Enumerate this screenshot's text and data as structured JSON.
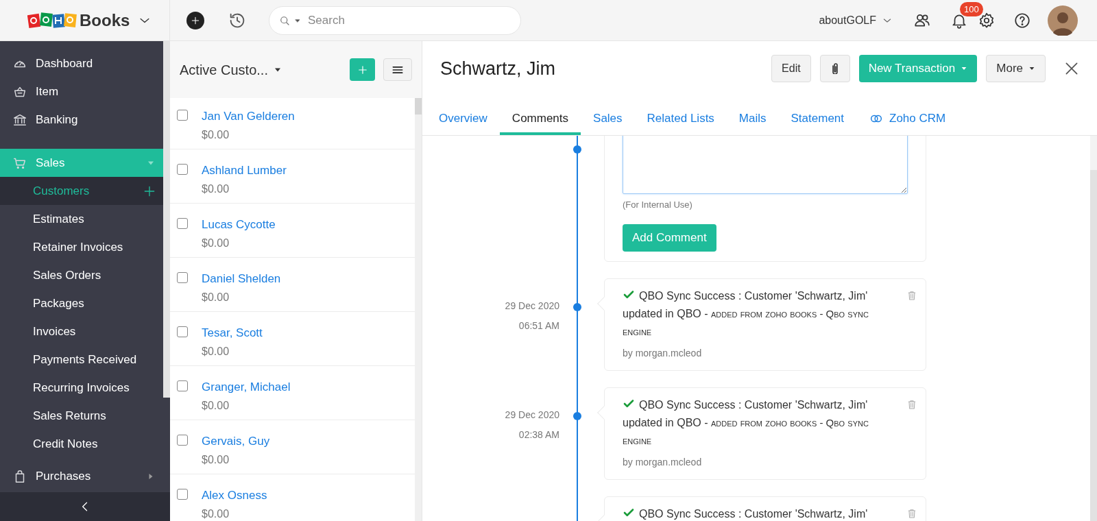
{
  "topbar": {
    "product": "Books",
    "search_placeholder": "Search",
    "organization": "aboutGOLF",
    "notification_count": "100"
  },
  "sidebar": {
    "items": [
      {
        "label": "Dashboard",
        "selected": false
      },
      {
        "label": "Item",
        "selected": false
      },
      {
        "label": "Banking",
        "selected": false
      },
      {
        "label": "Sales",
        "selected": true,
        "expanded": true,
        "children": [
          {
            "label": "Customers",
            "selected": true
          },
          {
            "label": "Estimates",
            "selected": false
          },
          {
            "label": "Retainer Invoices",
            "selected": false
          },
          {
            "label": "Sales Orders",
            "selected": false
          },
          {
            "label": "Packages",
            "selected": false
          },
          {
            "label": "Invoices",
            "selected": false
          },
          {
            "label": "Payments Received",
            "selected": false
          },
          {
            "label": "Recurring Invoices",
            "selected": false
          },
          {
            "label": "Sales Returns",
            "selected": false
          },
          {
            "label": "Credit Notes",
            "selected": false
          }
        ]
      },
      {
        "label": "Purchases",
        "selected": false,
        "expanded": false
      }
    ]
  },
  "customer_list": {
    "view": "Active Custo...",
    "rows": [
      {
        "name": "Jan Van Gelderen",
        "amount": "$0.00",
        "checked": false
      },
      {
        "name": "Ashland Lumber",
        "amount": "$0.00",
        "checked": false
      },
      {
        "name": "Lucas Cycotte",
        "amount": "$0.00",
        "checked": false
      },
      {
        "name": "Daniel Shelden",
        "amount": "$0.00",
        "checked": false
      },
      {
        "name": "Tesar, Scott",
        "amount": "$0.00",
        "checked": false
      },
      {
        "name": "Granger, Michael",
        "amount": "$0.00",
        "checked": false
      },
      {
        "name": "Gervais, Guy",
        "amount": "$0.00",
        "checked": false
      },
      {
        "name": "Alex Osness",
        "amount": "$0.00",
        "checked": false
      }
    ]
  },
  "detail": {
    "title": "Schwartz, Jim",
    "buttons": {
      "edit": "Edit",
      "new_transaction": "New Transaction",
      "more": "More"
    },
    "tabs": [
      {
        "label": "Overview",
        "selected": false
      },
      {
        "label": "Comments",
        "selected": true
      },
      {
        "label": "Sales",
        "selected": false
      },
      {
        "label": "Related Lists",
        "selected": false
      },
      {
        "label": "Mails",
        "selected": false
      },
      {
        "label": "Statement",
        "selected": false
      },
      {
        "label": "Zoho CRM",
        "selected": false
      }
    ],
    "comment_form": {
      "note": "(For Internal Use)",
      "button": "Add Comment"
    },
    "comments": [
      {
        "date": "29 Dec 2020",
        "time": "06:51 AM",
        "message": "QBO Sync Success : Customer 'Schwartz, Jim' updated in QBO -",
        "source": "added from zoho books - Qbo sync engine",
        "author": "by morgan.mcleod"
      },
      {
        "date": "29 Dec 2020",
        "time": "02:38 AM",
        "message": "QBO Sync Success : Customer 'Schwartz, Jim' updated in QBO -",
        "source": "added from zoho books - Qbo sync engine",
        "author": "by morgan.mcleod"
      },
      {
        "message": "QBO Sync Success : Customer 'Schwartz, Jim'"
      }
    ]
  }
}
